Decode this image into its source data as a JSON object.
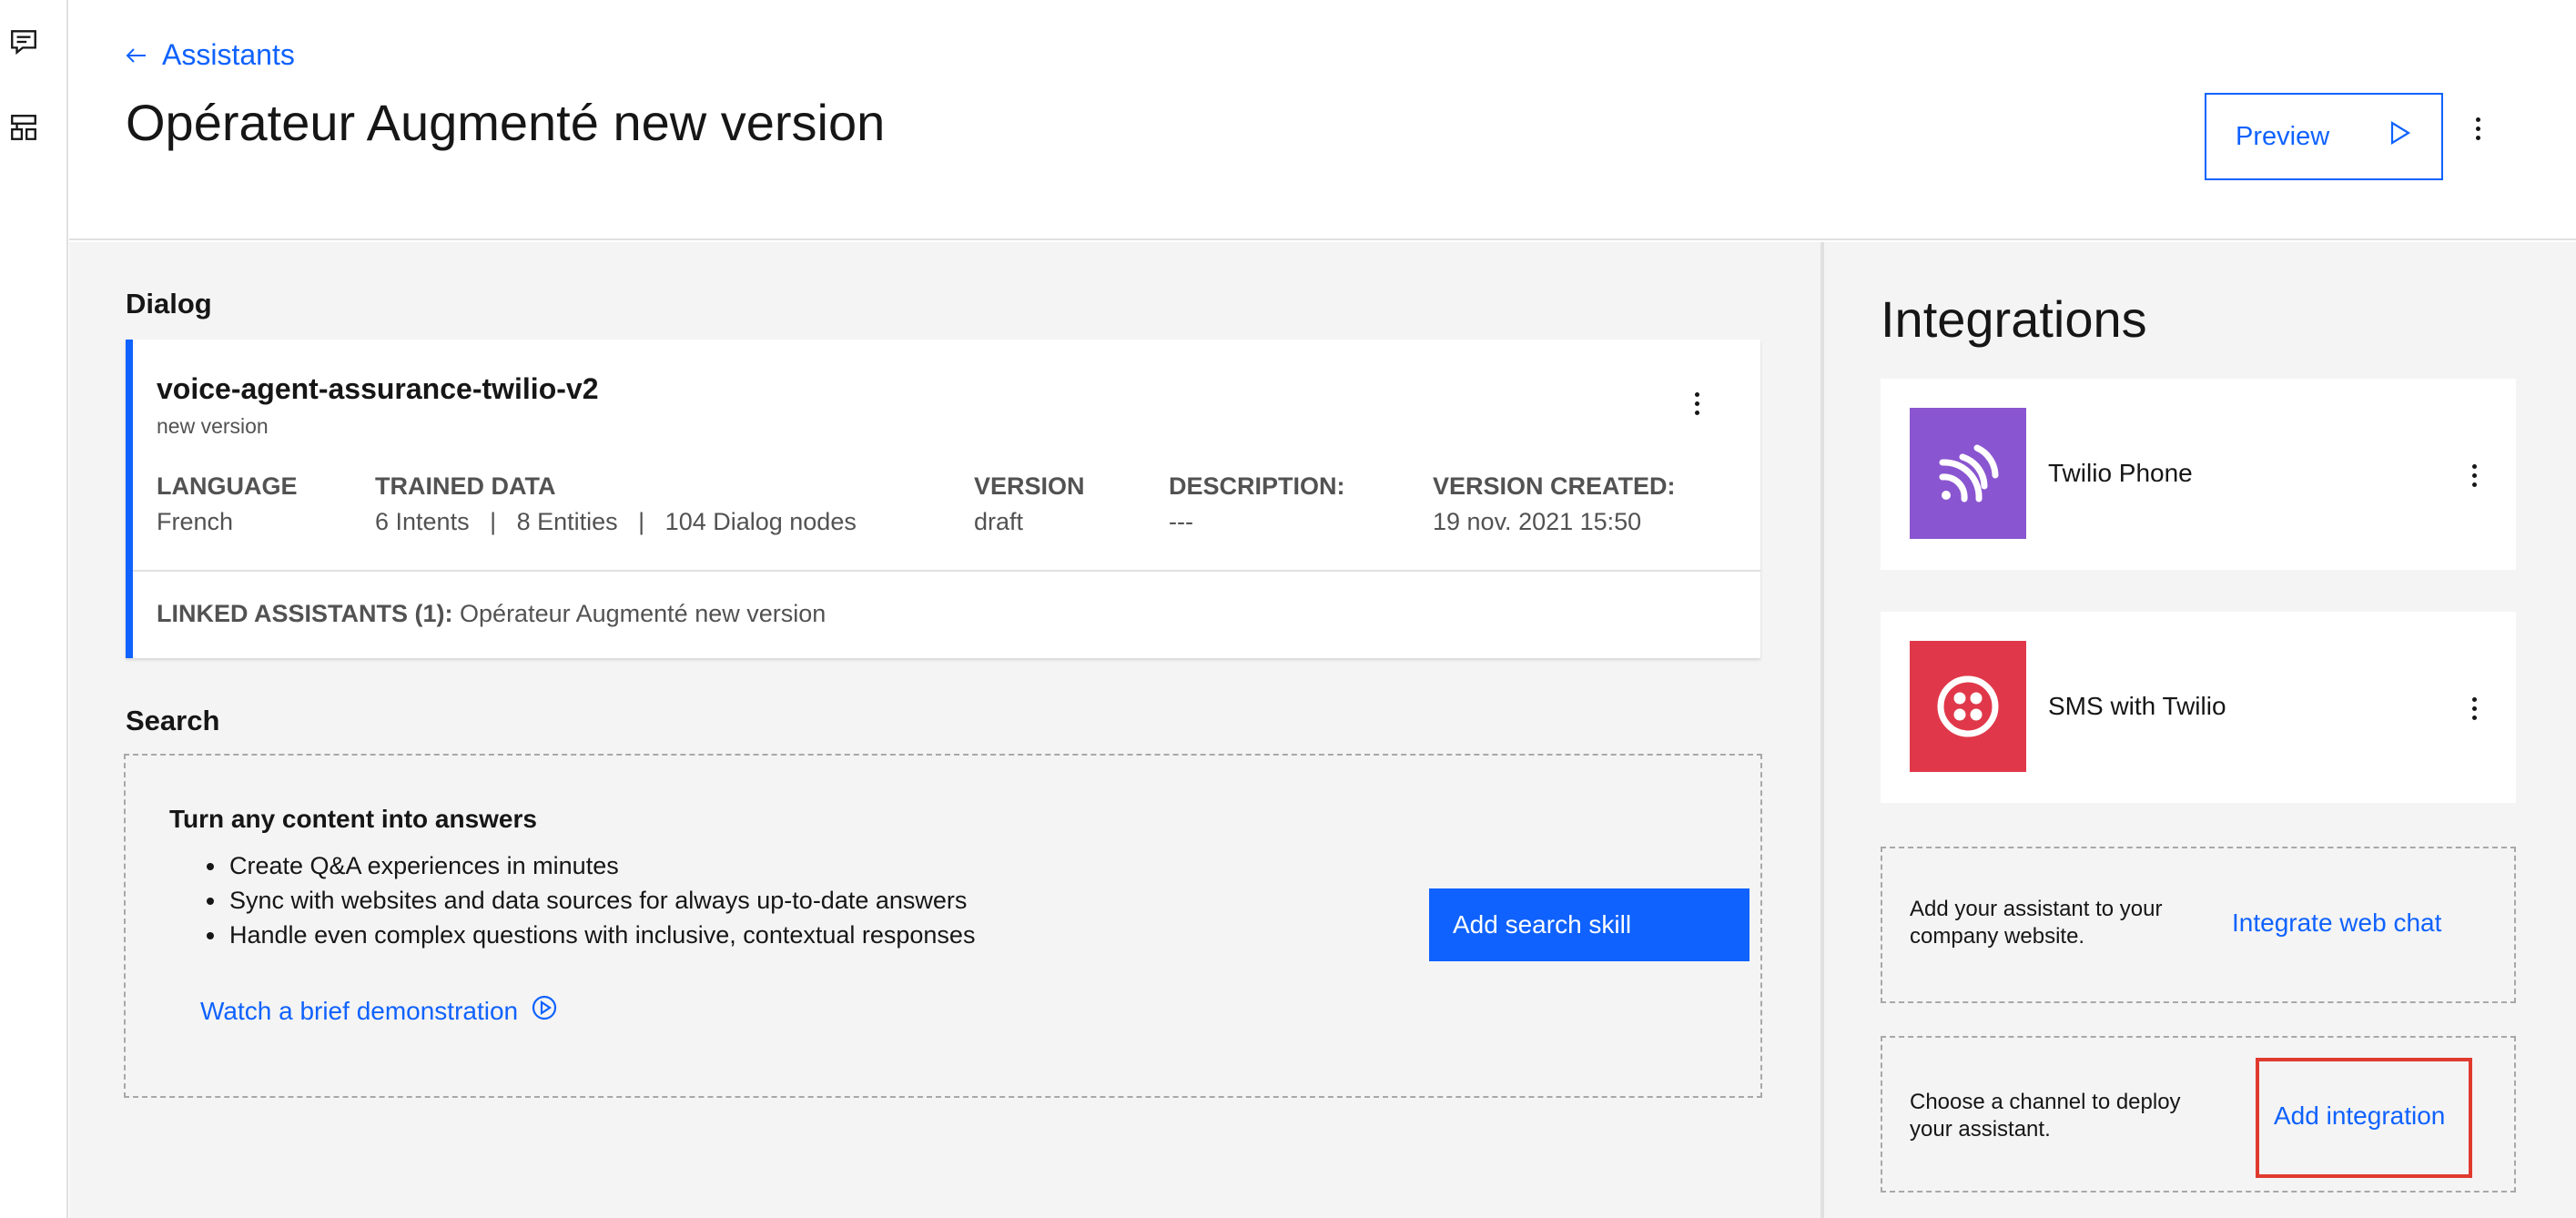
{
  "nav": {
    "back_label": "Assistants"
  },
  "header": {
    "title": "Opérateur Augmenté new version",
    "preview_label": "Preview"
  },
  "dialog": {
    "section_label": "Dialog",
    "skill_name": "voice-agent-assurance-twilio-v2",
    "skill_subtitle": "new version",
    "meta": {
      "language_label": "LANGUAGE",
      "language_value": "French",
      "trained_label": "TRAINED DATA",
      "trained_value": "6 Intents   |   8 Entities   |   104 Dialog nodes",
      "version_label": "VERSION",
      "version_value": "draft",
      "description_label": "DESCRIPTION:",
      "description_value": "---",
      "created_label": "VERSION CREATED:",
      "created_value": "19 nov. 2021 15:50"
    },
    "linked_label": "LINKED ASSISTANTS (1):",
    "linked_value": "Opérateur Augmenté new version"
  },
  "search": {
    "section_label": "Search",
    "title": "Turn any content into answers",
    "bullets": [
      "Create Q&A experiences in minutes",
      "Sync with websites and data sources for always up-to-date answers",
      "Handle even complex questions with inclusive, contextual responses"
    ],
    "demo_label": "Watch a brief demonstration",
    "add_button_label": "Add search skill"
  },
  "integrations": {
    "title": "Integrations",
    "items": [
      {
        "label": "Twilio Phone",
        "color": "#8a55d0",
        "icon": "phone-signal-icon"
      },
      {
        "label": "SMS with Twilio",
        "color": "#e0384a",
        "icon": "twilio-logo-icon"
      }
    ],
    "web_chat": {
      "text": "Add your assistant to your company website.",
      "link": "Integrate web chat"
    },
    "add": {
      "text": "Choose a channel to deploy your assistant.",
      "link": "Add integration"
    }
  },
  "colors": {
    "accent": "#0f62fe",
    "highlight": "#e03a2f",
    "panel_bg": "#f4f4f4"
  }
}
